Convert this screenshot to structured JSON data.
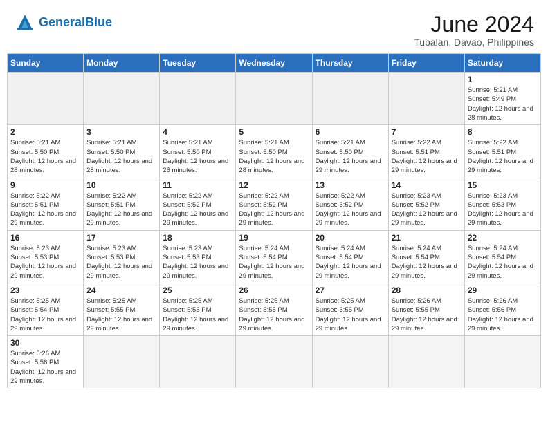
{
  "header": {
    "logo_text_normal": "General",
    "logo_text_blue": "Blue",
    "title": "June 2024",
    "subtitle": "Tubalan, Davao, Philippines"
  },
  "weekdays": [
    "Sunday",
    "Monday",
    "Tuesday",
    "Wednesday",
    "Thursday",
    "Friday",
    "Saturday"
  ],
  "days": [
    {
      "date": null,
      "empty": true
    },
    {
      "date": null,
      "empty": true
    },
    {
      "date": null,
      "empty": true
    },
    {
      "date": null,
      "empty": true
    },
    {
      "date": null,
      "empty": true
    },
    {
      "date": null,
      "empty": true
    },
    {
      "num": "1",
      "sunrise": "5:21 AM",
      "sunset": "5:49 PM",
      "daylight": "12 hours and 28 minutes."
    },
    {
      "num": "2",
      "sunrise": "5:21 AM",
      "sunset": "5:50 PM",
      "daylight": "12 hours and 28 minutes."
    },
    {
      "num": "3",
      "sunrise": "5:21 AM",
      "sunset": "5:50 PM",
      "daylight": "12 hours and 28 minutes."
    },
    {
      "num": "4",
      "sunrise": "5:21 AM",
      "sunset": "5:50 PM",
      "daylight": "12 hours and 28 minutes."
    },
    {
      "num": "5",
      "sunrise": "5:21 AM",
      "sunset": "5:50 PM",
      "daylight": "12 hours and 28 minutes."
    },
    {
      "num": "6",
      "sunrise": "5:21 AM",
      "sunset": "5:50 PM",
      "daylight": "12 hours and 29 minutes."
    },
    {
      "num": "7",
      "sunrise": "5:22 AM",
      "sunset": "5:51 PM",
      "daylight": "12 hours and 29 minutes."
    },
    {
      "num": "8",
      "sunrise": "5:22 AM",
      "sunset": "5:51 PM",
      "daylight": "12 hours and 29 minutes."
    },
    {
      "num": "9",
      "sunrise": "5:22 AM",
      "sunset": "5:51 PM",
      "daylight": "12 hours and 29 minutes."
    },
    {
      "num": "10",
      "sunrise": "5:22 AM",
      "sunset": "5:51 PM",
      "daylight": "12 hours and 29 minutes."
    },
    {
      "num": "11",
      "sunrise": "5:22 AM",
      "sunset": "5:52 PM",
      "daylight": "12 hours and 29 minutes."
    },
    {
      "num": "12",
      "sunrise": "5:22 AM",
      "sunset": "5:52 PM",
      "daylight": "12 hours and 29 minutes."
    },
    {
      "num": "13",
      "sunrise": "5:22 AM",
      "sunset": "5:52 PM",
      "daylight": "12 hours and 29 minutes."
    },
    {
      "num": "14",
      "sunrise": "5:23 AM",
      "sunset": "5:52 PM",
      "daylight": "12 hours and 29 minutes."
    },
    {
      "num": "15",
      "sunrise": "5:23 AM",
      "sunset": "5:53 PM",
      "daylight": "12 hours and 29 minutes."
    },
    {
      "num": "16",
      "sunrise": "5:23 AM",
      "sunset": "5:53 PM",
      "daylight": "12 hours and 29 minutes."
    },
    {
      "num": "17",
      "sunrise": "5:23 AM",
      "sunset": "5:53 PM",
      "daylight": "12 hours and 29 minutes."
    },
    {
      "num": "18",
      "sunrise": "5:23 AM",
      "sunset": "5:53 PM",
      "daylight": "12 hours and 29 minutes."
    },
    {
      "num": "19",
      "sunrise": "5:24 AM",
      "sunset": "5:54 PM",
      "daylight": "12 hours and 29 minutes."
    },
    {
      "num": "20",
      "sunrise": "5:24 AM",
      "sunset": "5:54 PM",
      "daylight": "12 hours and 29 minutes."
    },
    {
      "num": "21",
      "sunrise": "5:24 AM",
      "sunset": "5:54 PM",
      "daylight": "12 hours and 29 minutes."
    },
    {
      "num": "22",
      "sunrise": "5:24 AM",
      "sunset": "5:54 PM",
      "daylight": "12 hours and 29 minutes."
    },
    {
      "num": "23",
      "sunrise": "5:25 AM",
      "sunset": "5:54 PM",
      "daylight": "12 hours and 29 minutes."
    },
    {
      "num": "24",
      "sunrise": "5:25 AM",
      "sunset": "5:55 PM",
      "daylight": "12 hours and 29 minutes."
    },
    {
      "num": "25",
      "sunrise": "5:25 AM",
      "sunset": "5:55 PM",
      "daylight": "12 hours and 29 minutes."
    },
    {
      "num": "26",
      "sunrise": "5:25 AM",
      "sunset": "5:55 PM",
      "daylight": "12 hours and 29 minutes."
    },
    {
      "num": "27",
      "sunrise": "5:25 AM",
      "sunset": "5:55 PM",
      "daylight": "12 hours and 29 minutes."
    },
    {
      "num": "28",
      "sunrise": "5:26 AM",
      "sunset": "5:55 PM",
      "daylight": "12 hours and 29 minutes."
    },
    {
      "num": "29",
      "sunrise": "5:26 AM",
      "sunset": "5:56 PM",
      "daylight": "12 hours and 29 minutes."
    },
    {
      "num": "30",
      "sunrise": "5:26 AM",
      "sunset": "5:56 PM",
      "daylight": "12 hours and 29 minutes."
    },
    {
      "date": null,
      "empty": true
    },
    {
      "date": null,
      "empty": true
    },
    {
      "date": null,
      "empty": true
    },
    {
      "date": null,
      "empty": true
    },
    {
      "date": null,
      "empty": true
    },
    {
      "date": null,
      "empty": true
    }
  ],
  "labels": {
    "sunrise": "Sunrise:",
    "sunset": "Sunset:",
    "daylight": "Daylight:"
  }
}
